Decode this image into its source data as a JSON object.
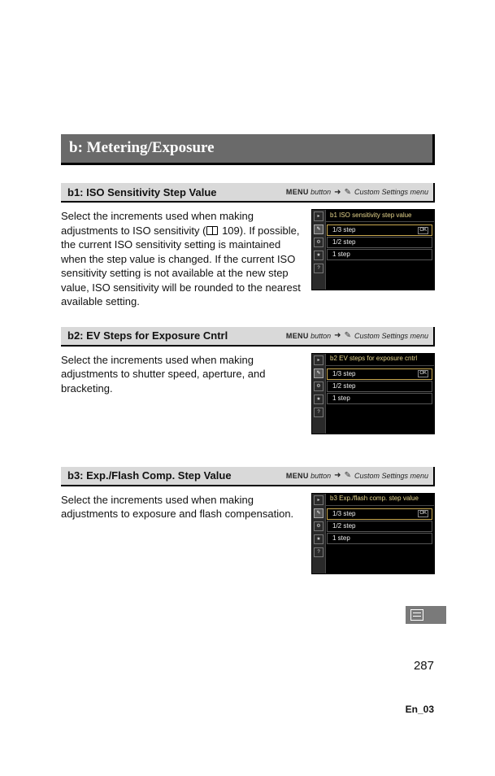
{
  "section_title": "b: Metering/Exposure",
  "nav": {
    "menu_label": "MENU",
    "button_word": "button",
    "csm_label": "Custom Settings menu"
  },
  "b1": {
    "title": "b1: ISO Sensitivity Step Value",
    "body_pre": "Select the increments used when making adjustments to ISO sensitivity (",
    "body_ref": "109",
    "body_post": "). If possible, the current ISO sensitivity setting is maintained when the step value is changed. If the current ISO sensitivity setting is not available at the new step value, ISO sensitivity will be rounded to the nearest available setting.",
    "thumb_header": "b1 ISO sensitivity step value",
    "rows": [
      "1/3 step",
      "1/2 step",
      "1 step"
    ]
  },
  "b2": {
    "title": "b2: EV Steps for Exposure Cntrl",
    "body": "Select the increments used when making adjustments to shutter speed, aperture, and bracketing.",
    "thumb_header": "b2 EV steps for exposure cntrl",
    "rows": [
      "1/3 step",
      "1/2 step",
      "1 step"
    ]
  },
  "b3": {
    "title": "b3: Exp./Flash Comp. Step Value",
    "body": "Select the increments used when making adjustments to exposure and flash compensation.",
    "thumb_header": "b3 Exp./flash comp. step value",
    "rows": [
      "1/3 step",
      "1/2 step",
      "1 step"
    ]
  },
  "page_number": "287",
  "doc_id": "En_03"
}
